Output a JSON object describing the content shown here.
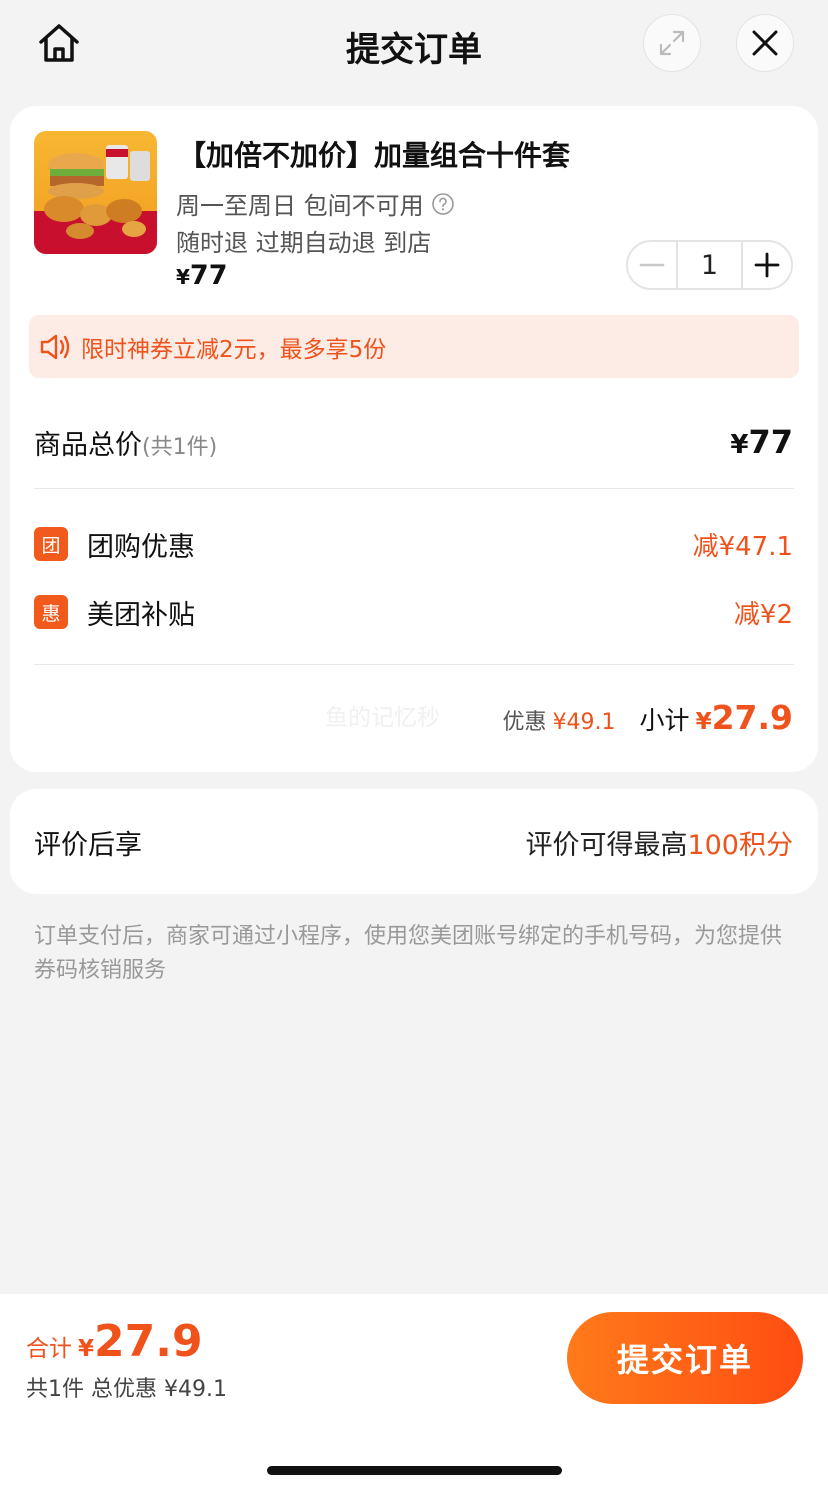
{
  "header": {
    "title": "提交订单",
    "home_icon": "home-icon",
    "expand_icon": "expand-icon",
    "close_icon": "close-icon"
  },
  "product": {
    "image_icon": "food-combo-image",
    "title": "【加倍不加价】加量组合十件套",
    "availability": "周一至周日 包间不可用",
    "refund_policy": "随时退 过期自动退 到店",
    "price_symbol": "¥",
    "price": "77",
    "quantity": "1"
  },
  "promo": {
    "icon": "speaker-icon",
    "text": "限时神券立减2元，最多享5份"
  },
  "totals": {
    "label": "商品总价",
    "count_text": "(共1件)",
    "symbol": "¥",
    "amount": "77"
  },
  "discounts": [
    {
      "badge": "团",
      "label": "团购优惠",
      "amount": "减¥47.1"
    },
    {
      "badge": "惠",
      "label": "美团补贴",
      "amount": "减¥2"
    }
  ],
  "watermark": "鱼的记忆秒",
  "summary": {
    "discount_label": "优惠",
    "discount_value": "¥49.1",
    "subtotal_label": "小计",
    "subtotal_symbol": "¥",
    "subtotal_value": "27.9"
  },
  "review": {
    "left": "评价后享",
    "right_prefix": "评价可得最高",
    "right_points": "100积分"
  },
  "notice": "订单支付后，商家可通过小程序，使用您美团账号绑定的手机号码，为您提供券码核销服务",
  "bottom": {
    "total_label": "合计",
    "total_symbol": "¥",
    "total_value": "27.9",
    "summary": "共1件 总优惠 ¥49.1",
    "submit_label": "提交订单"
  },
  "colors": {
    "accent": "#f0521c",
    "promo_bg": "#fdece6",
    "button_start": "#ff7a1a",
    "button_end": "#ff4d12"
  }
}
